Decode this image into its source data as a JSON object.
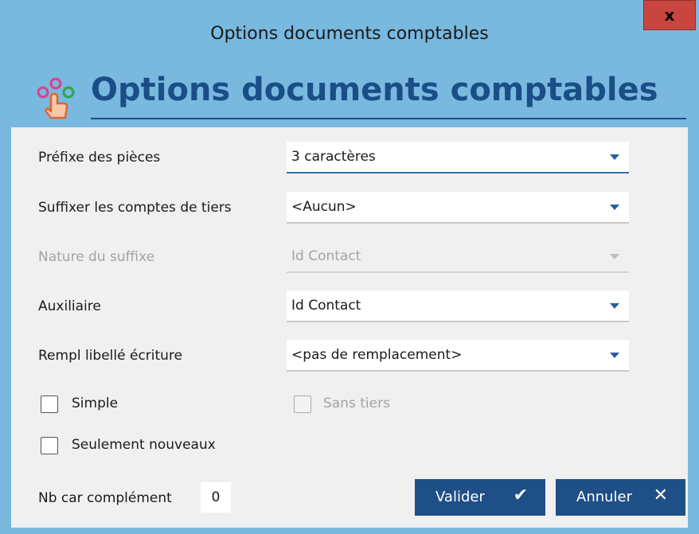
{
  "window": {
    "title": "Options documents comptables",
    "close_label": "x"
  },
  "header": {
    "heading": "Options documents comptables",
    "logo_icon": "options-pointer-icon"
  },
  "fields": {
    "prefixe": {
      "label": "Préfixe des pièces",
      "value": "3 caractères"
    },
    "suffixer": {
      "label": "Suffixer les comptes de tiers",
      "value": "<Aucun>"
    },
    "nature": {
      "label": "Nature du suffixe",
      "value": "Id Contact",
      "disabled": true
    },
    "auxiliaire": {
      "label": "Auxiliaire",
      "value": "Id Contact"
    },
    "rempl": {
      "label": "Rempl libellé écriture",
      "value": "<pas de remplacement>"
    }
  },
  "checkboxes": {
    "simple": {
      "label": "Simple",
      "checked": false
    },
    "sans_tiers": {
      "label": "Sans tiers",
      "checked": false,
      "disabled": true
    },
    "seulement": {
      "label": "Seulement nouveaux",
      "checked": false
    }
  },
  "complement": {
    "label": "Nb car complément",
    "value": "0"
  },
  "buttons": {
    "valider": {
      "label": "Valider",
      "icon": "✔"
    },
    "annuler": {
      "label": "Annuler",
      "icon": "✕"
    }
  },
  "colors": {
    "title_bg": "#79b8df",
    "heading": "#1a4e86",
    "button": "#1f4f87",
    "close": "#c8463f"
  }
}
